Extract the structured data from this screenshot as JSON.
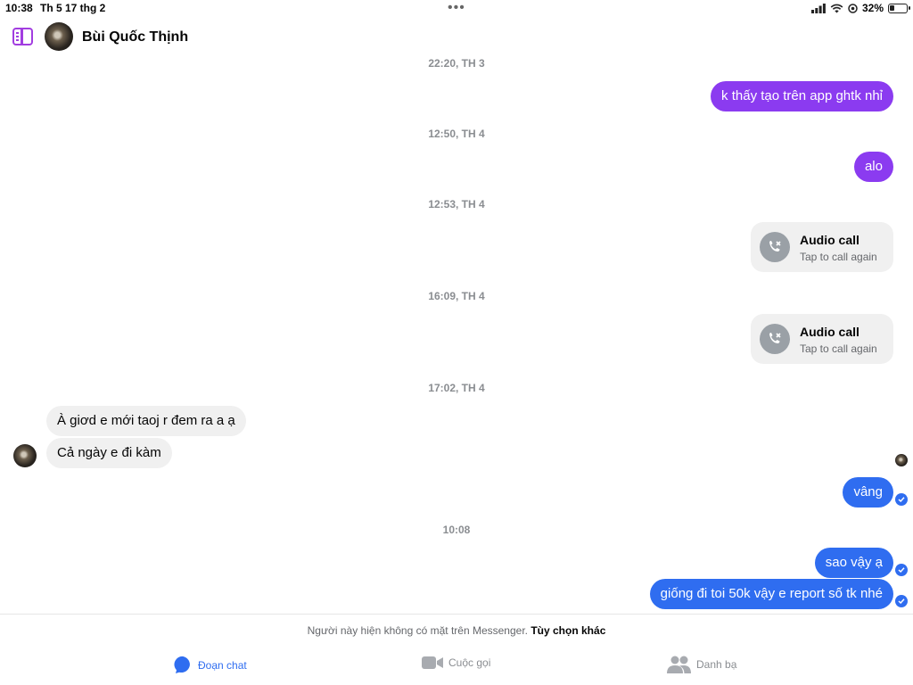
{
  "status_bar": {
    "time": "10:38",
    "date": "Th 5 17 thg 2",
    "more": "•••",
    "battery": "32%",
    "battery_level_pct": 32
  },
  "header": {
    "contact_name": "Bùi Quốc Thịnh"
  },
  "messages": {
    "ts1": "22:20, TH 3",
    "m1": "k thấy tạo trên app ghtk nhỉ",
    "ts2": "12:50, TH 4",
    "m2": "alo",
    "ts3": "12:53, TH 4",
    "call1_title": "Audio call",
    "call1_sub": "Tap to call again",
    "ts4": "16:09, TH 4",
    "call2_title": "Audio call",
    "call2_sub": "Tap to call again",
    "ts5": "17:02, TH 4",
    "in1": "À giơd e mới taoj r đem ra a ạ",
    "in2": "Cả ngày e đi kàm",
    "m3": "vâng",
    "ts6": "10:08",
    "m4": "sao vậy ạ",
    "m5": "giống đi toi 50k vậy e report số tk nhé"
  },
  "footer": {
    "notice_text": "Người này hiện không có mặt trên Messenger.",
    "notice_link": "Tùy chọn khác",
    "tabs": [
      {
        "label": "Đoạn chat",
        "icon": "chat-bubble-icon"
      },
      {
        "label": "Cuộc gọi",
        "icon": "video-camera-icon"
      },
      {
        "label": "Danh bạ",
        "icon": "people-icon"
      }
    ]
  },
  "colors": {
    "accent_purple": "#8b3bf0",
    "accent_blue": "#2f6df0",
    "bubble_gray": "#f0f0f0"
  }
}
